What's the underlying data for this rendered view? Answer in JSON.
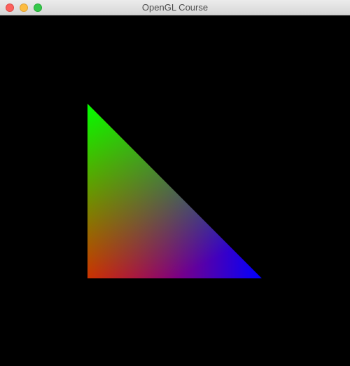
{
  "window": {
    "title": "OpenGL Course"
  },
  "viewport": {
    "clear_color": "#000000"
  },
  "triangle": {
    "vertices": [
      {
        "name": "top",
        "color": "#00ff00"
      },
      {
        "name": "bottom-left",
        "color": "#ff0000"
      },
      {
        "name": "bottom-right",
        "color": "#0000ff"
      }
    ]
  },
  "controls": {
    "close_color": "#fc615d",
    "minimize_color": "#fdbc40",
    "zoom_color": "#34c84a"
  }
}
